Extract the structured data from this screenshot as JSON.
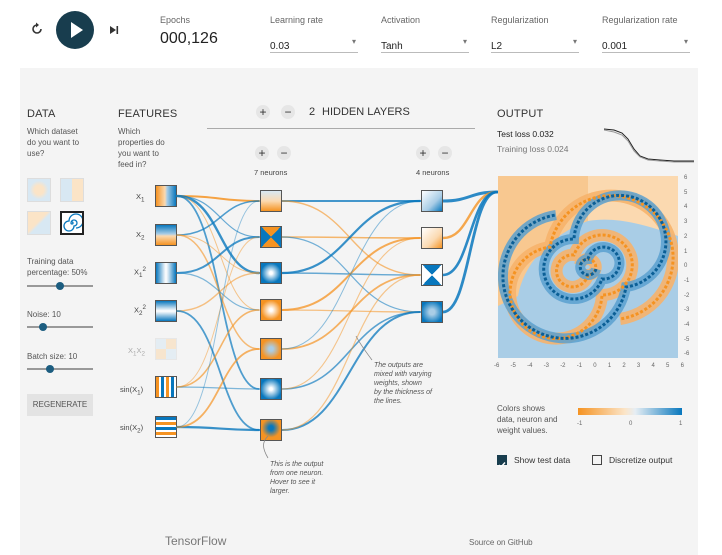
{
  "controls": {
    "epochs_label": "Epochs",
    "epochs_value": "000,126",
    "learning_rate_label": "Learning rate",
    "learning_rate_value": "0.03",
    "activation_label": "Activation",
    "activation_value": "Tanh",
    "regularization_label": "Regularization",
    "regularization_value": "L2",
    "reg_rate_label": "Regularization rate",
    "reg_rate_value": "0.001"
  },
  "data_panel": {
    "title": "DATA",
    "question": [
      "Which dataset",
      "do you want to",
      "use?"
    ],
    "training_label": "Training data",
    "training_pct": "percentage:  50%",
    "training_fraction": 0.5,
    "noise_label": "Noise:  10",
    "noise_fraction": 0.2,
    "batch_label": "Batch size:  10",
    "batch_fraction": 0.33,
    "regenerate": "REGENERATE"
  },
  "features_panel": {
    "title": "FEATURES",
    "question": [
      "Which",
      "properties do",
      "you want to",
      "feed in?"
    ],
    "features": [
      "X1",
      "X2",
      "X1²",
      "X2²",
      "X1X2",
      "sin(X1)",
      "sin(X2)"
    ]
  },
  "network": {
    "plus": "+",
    "minus": "−",
    "hidden_count": "2",
    "hidden_label": "HIDDEN LAYERS",
    "layer1_label": "7 neurons",
    "layer2_label": "4 neurons",
    "note_output": [
      "This is the output",
      "from one neuron.",
      "Hover to see it",
      "larger."
    ],
    "note_weights": [
      "The outputs are",
      "mixed with varying",
      "weights, shown",
      "by the thickness of",
      "the lines."
    ]
  },
  "output_panel": {
    "title": "OUTPUT",
    "test_loss": "Test loss 0.032",
    "training_loss": "Training loss 0.024",
    "y_ticks": [
      "6",
      "5",
      "4",
      "3",
      "2",
      "1",
      "0",
      "-1",
      "-2",
      "-3",
      "-4",
      "-5",
      "-6"
    ],
    "x_ticks": [
      "-6",
      "-5",
      "-4",
      "-3",
      "-2",
      "-1",
      "0",
      "1",
      "2",
      "3",
      "4",
      "5",
      "6"
    ],
    "colors_text": [
      "Colors shows",
      "data, neuron and",
      "weight values."
    ],
    "scale_left": "-1",
    "scale_mid": "0",
    "scale_right": "1",
    "show_test": "Show test data",
    "discretize": "Discretize output",
    "show_test_checked": true,
    "discretize_checked": false
  },
  "footer": {
    "brand": "TensorFlow",
    "source": "Source on GitHub"
  },
  "colors": {
    "orange": "#f59322",
    "blue": "#0877bd",
    "dark_button": "#183d4e"
  }
}
